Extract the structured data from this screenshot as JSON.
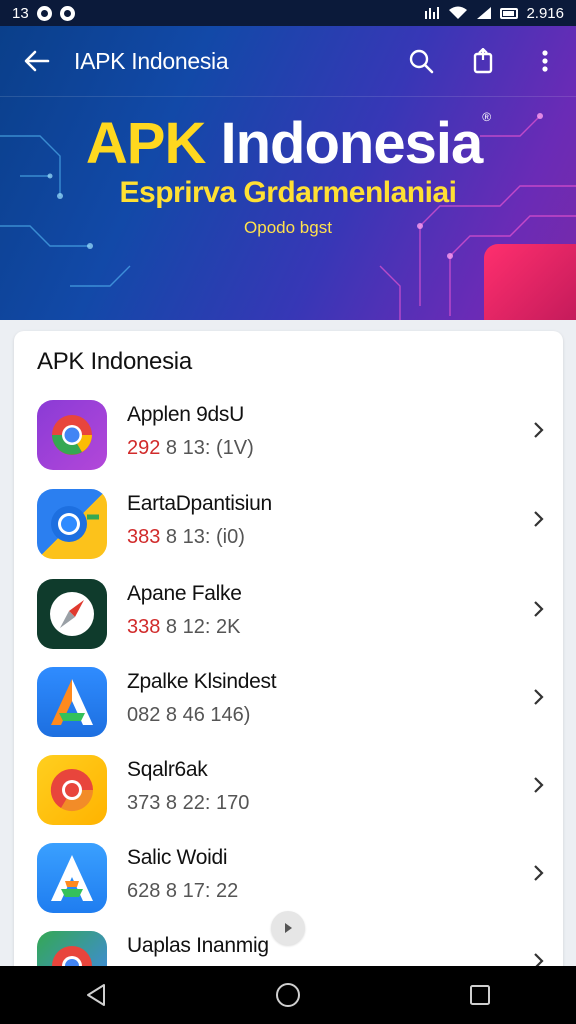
{
  "status_bar": {
    "time": "13",
    "right_text": "2.916"
  },
  "app_bar": {
    "title": "IAPK Indonesia",
    "back_icon": "arrow-left-icon",
    "search_icon": "search-icon",
    "share_icon": "share-icon",
    "menu_icon": "more-vert-icon"
  },
  "hero": {
    "title_part1": "APK",
    "title_part2": "Indonesia",
    "registered_mark": "®",
    "subtitle": "Esprirva Grdarmenlaniai",
    "tagline": "Opodo bgst",
    "colors": {
      "title_accent": "#ffd81f",
      "subtitle": "#ffe033",
      "block": "#ff2f6e"
    }
  },
  "card": {
    "title": "APK Indonesia",
    "apps": [
      {
        "name": "Applen 9dsU",
        "meta_lead": "292",
        "meta_rest": " 8 13:  (1V)",
        "icon": "chrome-purple-icon"
      },
      {
        "name": "EartaDpantisiun",
        "meta_lead": "383",
        "meta_rest": " 8 13:  (i0)",
        "icon": "chrome-blue-icon"
      },
      {
        "name": "Apane Falke",
        "meta_lead": "338",
        "meta_rest": " 8 12:  2K",
        "icon": "compass-icon"
      },
      {
        "name": "Zpalke Klsindest",
        "meta_lead": "082",
        "meta_rest": " 8 46  146)",
        "icon": "a-logo-icon"
      },
      {
        "name": "Sqalr6ak",
        "meta_lead": "373",
        "meta_rest": " 8 22:  170",
        "icon": "chrome-yellow-icon"
      },
      {
        "name": "Salic Woidi",
        "meta_lead": "628",
        "meta_rest": " 8 17:  22",
        "icon": "a-blue-icon"
      },
      {
        "name": "Uaplas Inanmig",
        "meta_lead": "",
        "meta_rest": "",
        "icon": "chrome-partial-icon"
      }
    ]
  },
  "nav_bar": {
    "back_icon": "nav-back-icon",
    "home_icon": "nav-home-icon",
    "recents_icon": "nav-recents-icon"
  }
}
